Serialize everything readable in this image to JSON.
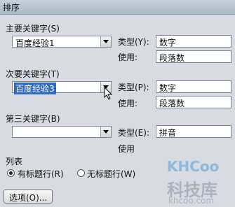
{
  "title": "排序",
  "primary": {
    "label": "主要关键字(S)",
    "value": "百度经验1",
    "type_label": "类型(Y):",
    "type_value": "数字",
    "using_label": "使用:",
    "using_value": "段落数"
  },
  "secondary": {
    "label": "次要关键字(T)",
    "value": "百度经验3",
    "type_label": "类型(P):",
    "type_value": "数字",
    "using_label": "使用:",
    "using_value": "段落数"
  },
  "tertiary": {
    "label": "第三关键字(B)",
    "value": "",
    "type_label": "类型(E):",
    "type_value": "拼音",
    "using_label": "使用"
  },
  "list": {
    "label": "列表",
    "has_header": "有标题行(R)",
    "no_header": "无标题行(W)",
    "selected": "has_header"
  },
  "options_button": "选项(O)...",
  "watermark": {
    "logo": "KHCoo",
    "text": "科技库",
    "url": "khcoo.com"
  },
  "colors": {
    "selection": "#316ac5",
    "dialog_bg": "#d8dce2",
    "watermark": "#8fb8dd"
  }
}
